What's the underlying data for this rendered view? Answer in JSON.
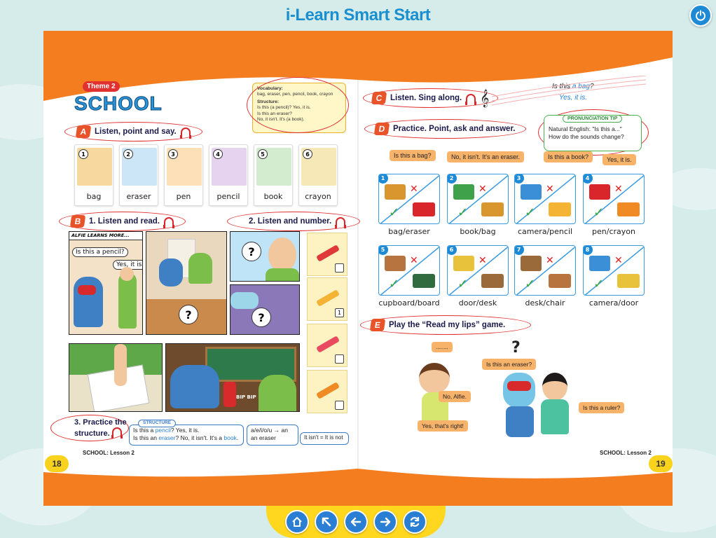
{
  "app": {
    "title": "i-Learn Smart Start"
  },
  "theme": {
    "badge": "Theme 2",
    "title": "SCHOOL",
    "lesson_tag": "LESSON 2"
  },
  "vocab_box": {
    "vocab_label": "Vocabulary:",
    "vocab_words": "bag, eraser, pen, pencil, book, crayon",
    "structure_label": "Structure:",
    "structure_lines": [
      "Is this (a pencil)? Yes, it is.",
      "Is this an eraser?",
      "No, it isn't. It's (a book)."
    ]
  },
  "section_a": {
    "letter": "A",
    "title": "Listen, point and say.",
    "audio": "37"
  },
  "cards": [
    {
      "num": "1",
      "label": "bag",
      "color": "#f7d9a0"
    },
    {
      "num": "2",
      "label": "eraser",
      "color": "#cde6f7"
    },
    {
      "num": "3",
      "label": "pen",
      "color": "#fde0b8"
    },
    {
      "num": "4",
      "label": "pencil",
      "color": "#e6d3ef"
    },
    {
      "num": "5",
      "label": "book",
      "color": "#d3ecd0"
    },
    {
      "num": "6",
      "label": "crayon",
      "color": "#f7e8b8"
    }
  ],
  "section_b": {
    "letter": "B",
    "title": "1. Listen and read.",
    "audio": "38"
  },
  "section_b2": {
    "title": "2. Listen and number.",
    "audio": "39"
  },
  "comic": {
    "header": "ALFIE LEARNS MORE...",
    "bubble1": "Is this a pencil?",
    "bubble2": "Yes, it is.",
    "beep": "BIP BIP"
  },
  "number_items": [
    {
      "item": "eraser",
      "answer": ""
    },
    {
      "item": "pencil",
      "answer": "1"
    },
    {
      "item": "pen",
      "answer": ""
    },
    {
      "item": "crayon",
      "answer": ""
    }
  ],
  "section_3": {
    "title_line1": "3. Practice the",
    "title_line2": "structure.",
    "audio": "40",
    "structure_tag": "STRUCTURE",
    "line1_pre": "Is this a ",
    "line1_blue": "pencil",
    "line1_post": "? Yes, it is.",
    "line2_pre": "Is this an ",
    "line2_blue": "eraser",
    "line2_mid": "? No, it isn't. It's a ",
    "line2_blue2": "book",
    "line2_end": ".",
    "vowel_line1": "a/e/i/o/u → an",
    "vowel_line2": "an eraser",
    "contraction": "It isn't = It is not"
  },
  "footer": {
    "left_page": "18",
    "left_label": "SCHOOL: Lesson 2",
    "right_page": "19",
    "right_label": "SCHOOL: Lesson 2"
  },
  "section_c": {
    "letter": "C",
    "title": "Listen. Sing along.",
    "audio": "41",
    "song1_pre": "Is this ",
    "song1_blue": "a bag",
    "song1_end": "?",
    "song2": "Yes, it is."
  },
  "section_d": {
    "letter": "D",
    "title": "Practice. Point, ask and answer."
  },
  "pron_tip": {
    "tag": "PRONUNCIATION TIP",
    "line1": "Natural English: \"Is this a...\"",
    "line2": "How do the sounds change?"
  },
  "chips": [
    "Is this a bag?",
    "No, it isn't. It's an eraser.",
    "Is this a book?",
    "Yes, it is."
  ],
  "pairs": [
    {
      "num": "1",
      "label": "bag/eraser"
    },
    {
      "num": "2",
      "label": "book/bag"
    },
    {
      "num": "3",
      "label": "camera/pencil"
    },
    {
      "num": "4",
      "label": "pen/crayon"
    },
    {
      "num": "5",
      "label": "cupboard/board"
    },
    {
      "num": "6",
      "label": "door/desk"
    },
    {
      "num": "7",
      "label": "desk/chair"
    },
    {
      "num": "8",
      "label": "camera/door"
    }
  ],
  "section_e": {
    "letter": "E",
    "title": "Play  the “Read my lips” game."
  },
  "game": {
    "dots": "........",
    "q": "?",
    "q_bubble": "Is this an eraser?",
    "no_bubble": "No, Alfie.",
    "yes_bubble": "Yes, that's right!",
    "ruler_bubble": "Is this a ruler?"
  },
  "nav": [
    "home-icon",
    "up-left-arrow-icon",
    "back-arrow-icon",
    "forward-arrow-icon",
    "refresh-icon"
  ],
  "colors": {
    "accent": "#1a8fcf",
    "orange": "#f47d20",
    "red": "#e03030",
    "nav": "#ffd71e"
  }
}
